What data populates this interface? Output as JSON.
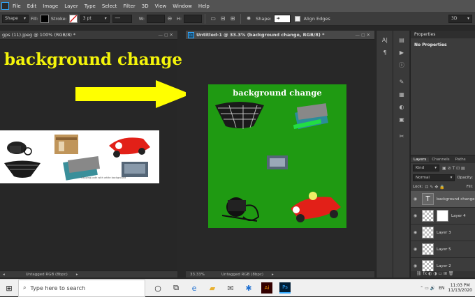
{
  "menu": [
    "File",
    "Edit",
    "Image",
    "Layer",
    "Type",
    "Select",
    "Filter",
    "3D",
    "View",
    "Window",
    "Help"
  ],
  "options": {
    "shape_mode": "Shape",
    "fill_label": "Fill:",
    "stroke_label": "Stroke:",
    "stroke_width": "3 pt",
    "w_label": "W:",
    "h_label": "H:",
    "shape_label": "Shape:",
    "align_edges": "Align Edges",
    "workspace": "3D"
  },
  "doc1": {
    "tab": "gps (11).jpeg @ 100% (RGB/8) *",
    "headline": "background change",
    "thumb_caption": "Clipping path with white background",
    "status_profile": "Untagged RGB (8bpc)"
  },
  "doc2": {
    "tab": "Untitled-1 @ 33.3% (background change, RGB/8) *",
    "headline": "background change",
    "zoom": "33.33%",
    "status_profile": "Untagged RGB (8bpc)"
  },
  "properties": {
    "title": "Properties",
    "empty_text": "No Properties"
  },
  "layers": {
    "tabs": [
      "Layers",
      "Channels",
      "Paths"
    ],
    "kind": "Kind",
    "blend": "Normal",
    "opacity_label": "Opacity:",
    "lock_label": "Lock:",
    "fill_label": "Fill:",
    "items": [
      {
        "name": "background change",
        "type": "text"
      },
      {
        "name": "Layer 4",
        "type": "mask"
      },
      {
        "name": "Layer 3",
        "type": "pixel"
      },
      {
        "name": "Layer 5",
        "type": "pixel"
      },
      {
        "name": "Layer 2",
        "type": "pixel"
      }
    ]
  },
  "taskbar": {
    "search_placeholder": "Type here to search",
    "time": "11:03 PM",
    "date": "11/13/2020",
    "lang": "EN"
  },
  "colors": {
    "green_bg": "#1f9a12",
    "headline_yellow": "#f5f50a",
    "arrow_yellow": "#ffff00"
  }
}
